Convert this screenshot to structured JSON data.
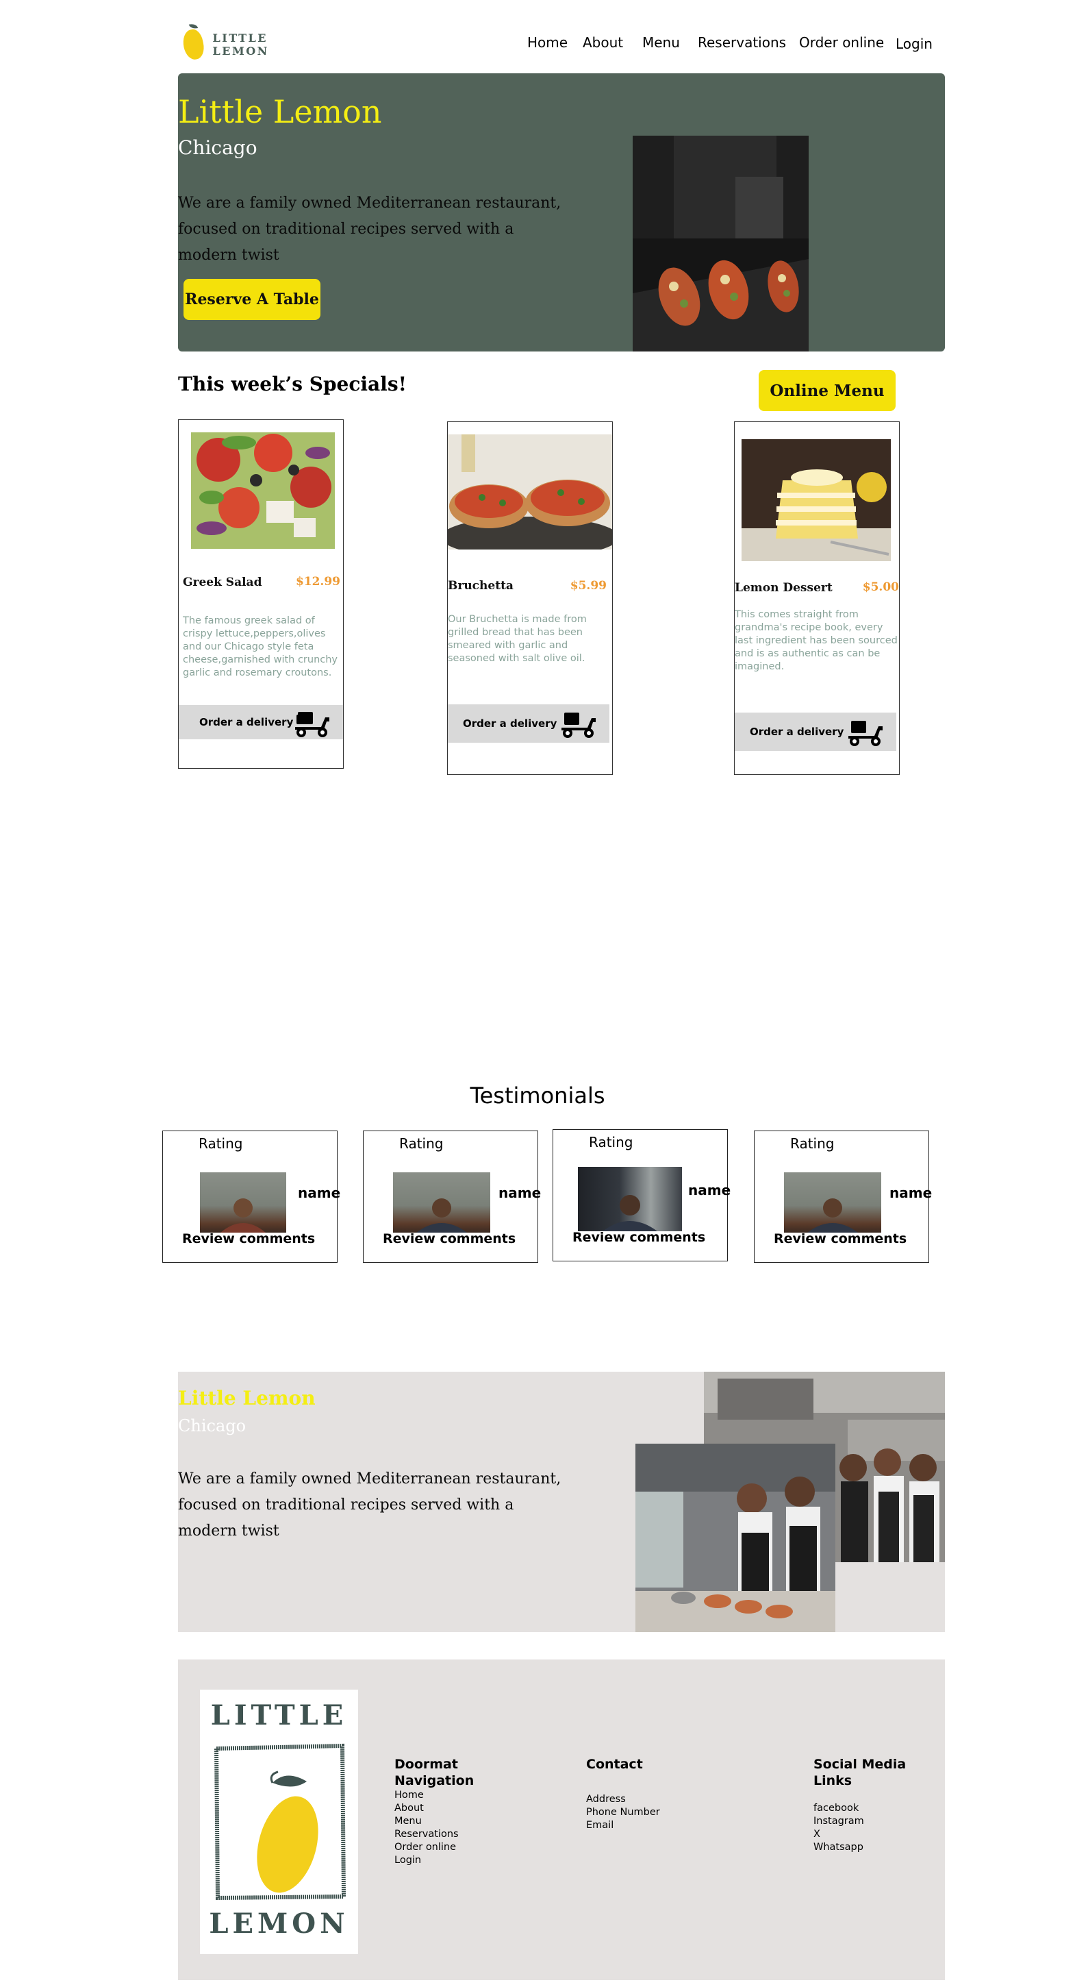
{
  "brand": {
    "logo_text": "LITTLE LEMON",
    "accent": "#f4ce14",
    "primary": "#495e57"
  },
  "nav": {
    "items": [
      "Home",
      "About",
      "Menu",
      "Reservations",
      "Order online",
      "Login"
    ]
  },
  "hero": {
    "title": "Little Lemon",
    "subtitle": "Chicago",
    "description": "We are a family owned Mediterranean restaurant, focused on traditional recipes served with a modern twist",
    "cta_label": "Reserve  A Table"
  },
  "specials": {
    "title": "This week’s Specials!",
    "online_menu_label": "Online Menu",
    "cards": [
      {
        "name": "Greek Salad",
        "price": "$12.99",
        "description": "The famous greek salad of crispy lettuce,peppers,olives and our Chicago style feta cheese,garnished with crunchy garlic and rosemary croutons.",
        "delivery_label": "Order a delivery"
      },
      {
        "name": "Bruchetta",
        "price": "$5.99",
        "description": "Our  Bruchetta is made from grilled bread that has been smeared with garlic and seasoned with salt olive oil.",
        "delivery_label": "Order a delivery"
      },
      {
        "name": "Lemon Dessert",
        "price": "$5.00",
        "description": "This comes straight from grandma's recipe  book, every last ingredient has been sourced and is as authentic as can be imagined.",
        "delivery_label": "Order a delivery"
      }
    ]
  },
  "testimonials": {
    "title": "Testimonials",
    "cards": [
      {
        "rating": "Rating",
        "name": "name",
        "comment": "Review comments"
      },
      {
        "rating": "Rating",
        "name": "name",
        "comment": "Review comments"
      },
      {
        "rating": "Rating",
        "name": "name",
        "comment": "Review comments"
      },
      {
        "rating": "Rating",
        "name": "name",
        "comment": "Review comments"
      }
    ]
  },
  "about": {
    "title": "Little Lemon",
    "subtitle": "Chicago",
    "description": "We are a family owned Mediterranean restaurant, focused on traditional recipes served with a modern twist"
  },
  "footer": {
    "logo_top": "LITTLE",
    "logo_bottom": "LEMON",
    "doormat": {
      "heading": "Doormat Navigation",
      "items": [
        "Home",
        "About",
        "Menu",
        "Reservations",
        "Order online",
        "Login"
      ]
    },
    "contact": {
      "heading": "Contact",
      "items": [
        "Address",
        "Phone Number",
        "Email"
      ]
    },
    "social": {
      "heading": "Social Media Links",
      "items": [
        "facebook",
        "Instagram",
        "X",
        "Whatsapp"
      ]
    }
  }
}
